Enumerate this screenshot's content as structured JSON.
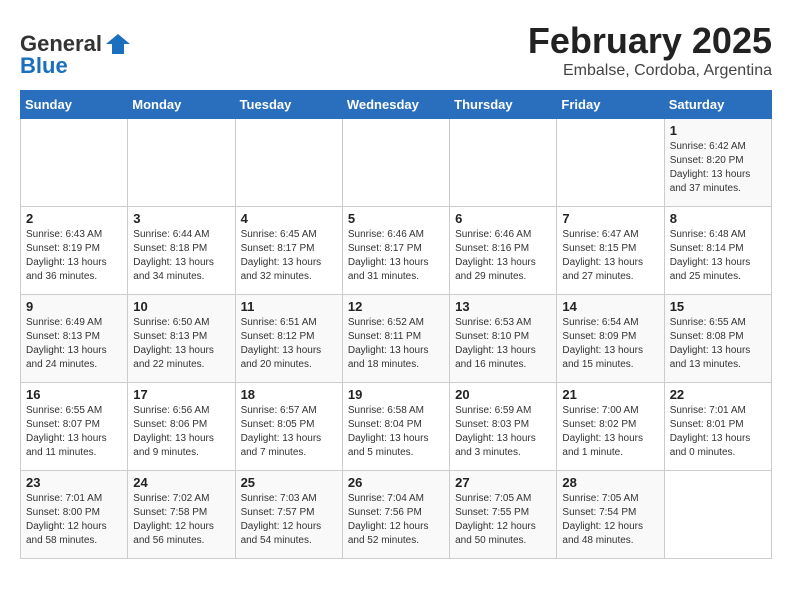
{
  "header": {
    "logo_general": "General",
    "logo_blue": "Blue",
    "month": "February 2025",
    "location": "Embalse, Cordoba, Argentina"
  },
  "weekdays": [
    "Sunday",
    "Monday",
    "Tuesday",
    "Wednesday",
    "Thursday",
    "Friday",
    "Saturday"
  ],
  "weeks": [
    [
      {
        "day": "",
        "info": ""
      },
      {
        "day": "",
        "info": ""
      },
      {
        "day": "",
        "info": ""
      },
      {
        "day": "",
        "info": ""
      },
      {
        "day": "",
        "info": ""
      },
      {
        "day": "",
        "info": ""
      },
      {
        "day": "1",
        "info": "Sunrise: 6:42 AM\nSunset: 8:20 PM\nDaylight: 13 hours\nand 37 minutes."
      }
    ],
    [
      {
        "day": "2",
        "info": "Sunrise: 6:43 AM\nSunset: 8:19 PM\nDaylight: 13 hours\nand 36 minutes."
      },
      {
        "day": "3",
        "info": "Sunrise: 6:44 AM\nSunset: 8:18 PM\nDaylight: 13 hours\nand 34 minutes."
      },
      {
        "day": "4",
        "info": "Sunrise: 6:45 AM\nSunset: 8:17 PM\nDaylight: 13 hours\nand 32 minutes."
      },
      {
        "day": "5",
        "info": "Sunrise: 6:46 AM\nSunset: 8:17 PM\nDaylight: 13 hours\nand 31 minutes."
      },
      {
        "day": "6",
        "info": "Sunrise: 6:46 AM\nSunset: 8:16 PM\nDaylight: 13 hours\nand 29 minutes."
      },
      {
        "day": "7",
        "info": "Sunrise: 6:47 AM\nSunset: 8:15 PM\nDaylight: 13 hours\nand 27 minutes."
      },
      {
        "day": "8",
        "info": "Sunrise: 6:48 AM\nSunset: 8:14 PM\nDaylight: 13 hours\nand 25 minutes."
      }
    ],
    [
      {
        "day": "9",
        "info": "Sunrise: 6:49 AM\nSunset: 8:13 PM\nDaylight: 13 hours\nand 24 minutes."
      },
      {
        "day": "10",
        "info": "Sunrise: 6:50 AM\nSunset: 8:13 PM\nDaylight: 13 hours\nand 22 minutes."
      },
      {
        "day": "11",
        "info": "Sunrise: 6:51 AM\nSunset: 8:12 PM\nDaylight: 13 hours\nand 20 minutes."
      },
      {
        "day": "12",
        "info": "Sunrise: 6:52 AM\nSunset: 8:11 PM\nDaylight: 13 hours\nand 18 minutes."
      },
      {
        "day": "13",
        "info": "Sunrise: 6:53 AM\nSunset: 8:10 PM\nDaylight: 13 hours\nand 16 minutes."
      },
      {
        "day": "14",
        "info": "Sunrise: 6:54 AM\nSunset: 8:09 PM\nDaylight: 13 hours\nand 15 minutes."
      },
      {
        "day": "15",
        "info": "Sunrise: 6:55 AM\nSunset: 8:08 PM\nDaylight: 13 hours\nand 13 minutes."
      }
    ],
    [
      {
        "day": "16",
        "info": "Sunrise: 6:55 AM\nSunset: 8:07 PM\nDaylight: 13 hours\nand 11 minutes."
      },
      {
        "day": "17",
        "info": "Sunrise: 6:56 AM\nSunset: 8:06 PM\nDaylight: 13 hours\nand 9 minutes."
      },
      {
        "day": "18",
        "info": "Sunrise: 6:57 AM\nSunset: 8:05 PM\nDaylight: 13 hours\nand 7 minutes."
      },
      {
        "day": "19",
        "info": "Sunrise: 6:58 AM\nSunset: 8:04 PM\nDaylight: 13 hours\nand 5 minutes."
      },
      {
        "day": "20",
        "info": "Sunrise: 6:59 AM\nSunset: 8:03 PM\nDaylight: 13 hours\nand 3 minutes."
      },
      {
        "day": "21",
        "info": "Sunrise: 7:00 AM\nSunset: 8:02 PM\nDaylight: 13 hours\nand 1 minute."
      },
      {
        "day": "22",
        "info": "Sunrise: 7:01 AM\nSunset: 8:01 PM\nDaylight: 13 hours\nand 0 minutes."
      }
    ],
    [
      {
        "day": "23",
        "info": "Sunrise: 7:01 AM\nSunset: 8:00 PM\nDaylight: 12 hours\nand 58 minutes."
      },
      {
        "day": "24",
        "info": "Sunrise: 7:02 AM\nSunset: 7:58 PM\nDaylight: 12 hours\nand 56 minutes."
      },
      {
        "day": "25",
        "info": "Sunrise: 7:03 AM\nSunset: 7:57 PM\nDaylight: 12 hours\nand 54 minutes."
      },
      {
        "day": "26",
        "info": "Sunrise: 7:04 AM\nSunset: 7:56 PM\nDaylight: 12 hours\nand 52 minutes."
      },
      {
        "day": "27",
        "info": "Sunrise: 7:05 AM\nSunset: 7:55 PM\nDaylight: 12 hours\nand 50 minutes."
      },
      {
        "day": "28",
        "info": "Sunrise: 7:05 AM\nSunset: 7:54 PM\nDaylight: 12 hours\nand 48 minutes."
      },
      {
        "day": "",
        "info": ""
      }
    ]
  ]
}
